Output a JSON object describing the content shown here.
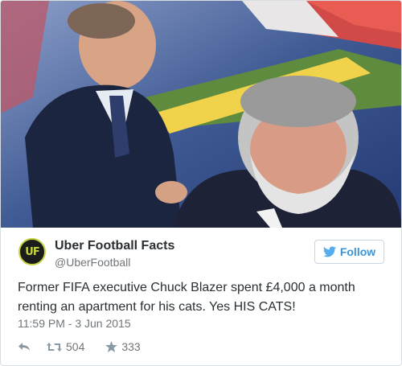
{
  "tweet": {
    "author_name": "Uber Football Facts",
    "author_handle": "@UberFootball",
    "avatar_text": "UF",
    "follow_label": "Follow",
    "text": "Former FIFA executive Chuck Blazer spent £4,000 a month renting an apartment for his cats. Yes HIS CATS!",
    "timestamp": "11:59 PM - 3 Jun 2015",
    "retweets": "504",
    "likes": "333"
  },
  "icons": {
    "follow": "bird-icon",
    "reply": "reply-icon",
    "retweet": "retweet-icon",
    "like": "star-icon"
  },
  "colors": {
    "accent": "#3b94d9",
    "avatar_ring": "#c7d33f",
    "text": "#292f33",
    "muted": "#707579"
  }
}
